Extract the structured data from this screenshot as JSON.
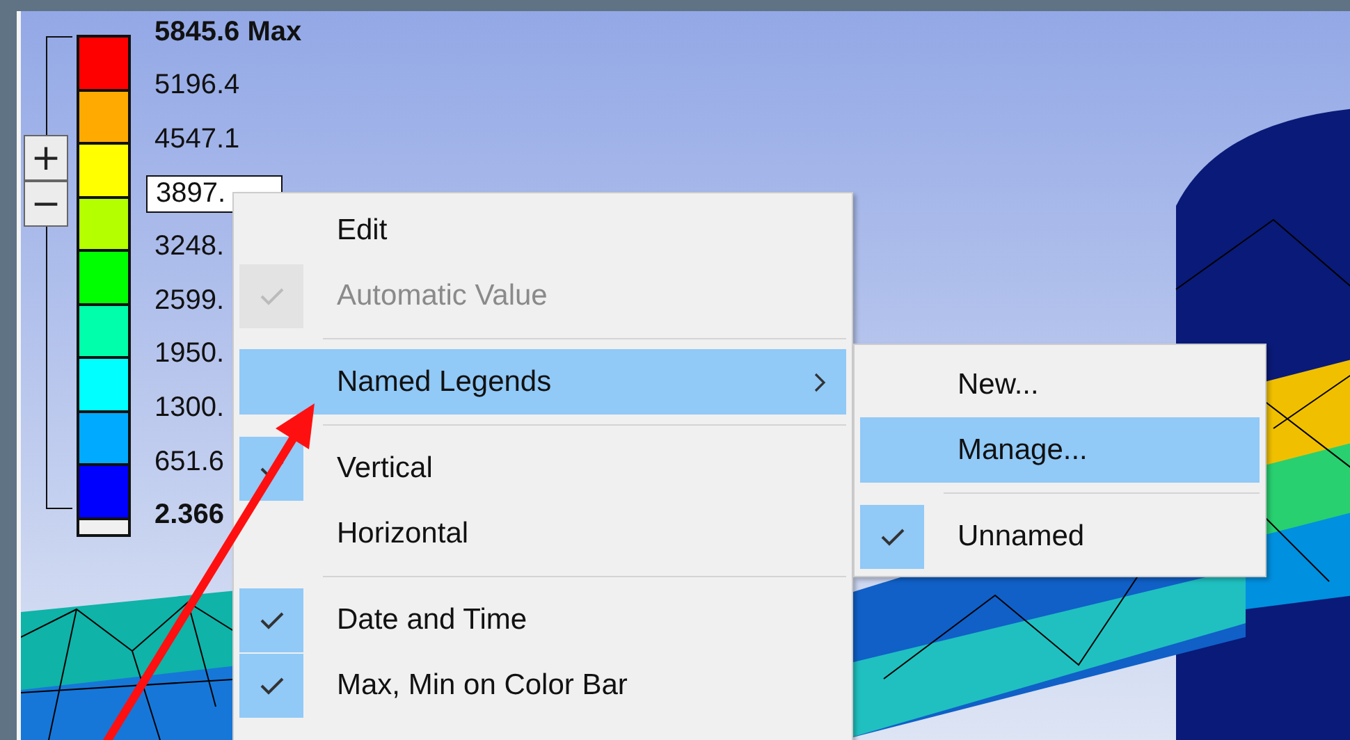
{
  "legend": {
    "plus_button": "+",
    "minus_button": "−",
    "bands": [
      {
        "color": "#ff0000"
      },
      {
        "color": "#ffaa00"
      },
      {
        "color": "#ffff00"
      },
      {
        "color": "#b4ff00"
      },
      {
        "color": "#00ff00"
      },
      {
        "color": "#00ffaa"
      },
      {
        "color": "#00ffff"
      },
      {
        "color": "#00aaff"
      },
      {
        "color": "#0000ff"
      }
    ],
    "labels": [
      {
        "text": "5845.6 Max",
        "kind": "max"
      },
      {
        "text": "5196.4",
        "kind": "plain"
      },
      {
        "text": "4547.1",
        "kind": "plain"
      },
      {
        "text": "3897.",
        "kind": "field"
      },
      {
        "text": "3248.",
        "kind": "plain"
      },
      {
        "text": "2599.",
        "kind": "plain"
      },
      {
        "text": "1950.",
        "kind": "plain"
      },
      {
        "text": "1300.",
        "kind": "plain"
      },
      {
        "text": "651.6",
        "kind": "plain"
      },
      {
        "text": "2.366",
        "kind": "min"
      }
    ]
  },
  "context_menu": {
    "items": [
      {
        "kind": "item",
        "label": "Edit",
        "checked": false,
        "disabled": false,
        "selected": false,
        "has_submenu": false
      },
      {
        "kind": "item",
        "label": "Automatic Value",
        "checked": true,
        "disabled": true,
        "selected": false,
        "has_submenu": false
      },
      {
        "kind": "separator"
      },
      {
        "kind": "item",
        "label": "Named Legends",
        "checked": false,
        "disabled": false,
        "selected": true,
        "has_submenu": true
      },
      {
        "kind": "separator"
      },
      {
        "kind": "item",
        "label": "Vertical",
        "checked": true,
        "disabled": false,
        "selected": false,
        "has_submenu": false
      },
      {
        "kind": "item",
        "label": "Horizontal",
        "checked": false,
        "disabled": false,
        "selected": false,
        "has_submenu": false
      },
      {
        "kind": "separator"
      },
      {
        "kind": "item",
        "label": "Date and Time",
        "checked": true,
        "disabled": false,
        "selected": false,
        "has_submenu": false
      },
      {
        "kind": "item",
        "label": "Max, Min on Color Bar",
        "checked": true,
        "disabled": false,
        "selected": false,
        "has_submenu": false
      }
    ]
  },
  "submenu": {
    "items": [
      {
        "kind": "item",
        "label": "New...",
        "checked": false,
        "disabled": false,
        "selected": false,
        "has_submenu": false
      },
      {
        "kind": "item",
        "label": "Manage...",
        "checked": false,
        "disabled": false,
        "selected": true,
        "has_submenu": false
      },
      {
        "kind": "separator"
      },
      {
        "kind": "item",
        "label": "Unnamed",
        "checked": true,
        "disabled": false,
        "selected": false,
        "has_submenu": false
      }
    ]
  }
}
